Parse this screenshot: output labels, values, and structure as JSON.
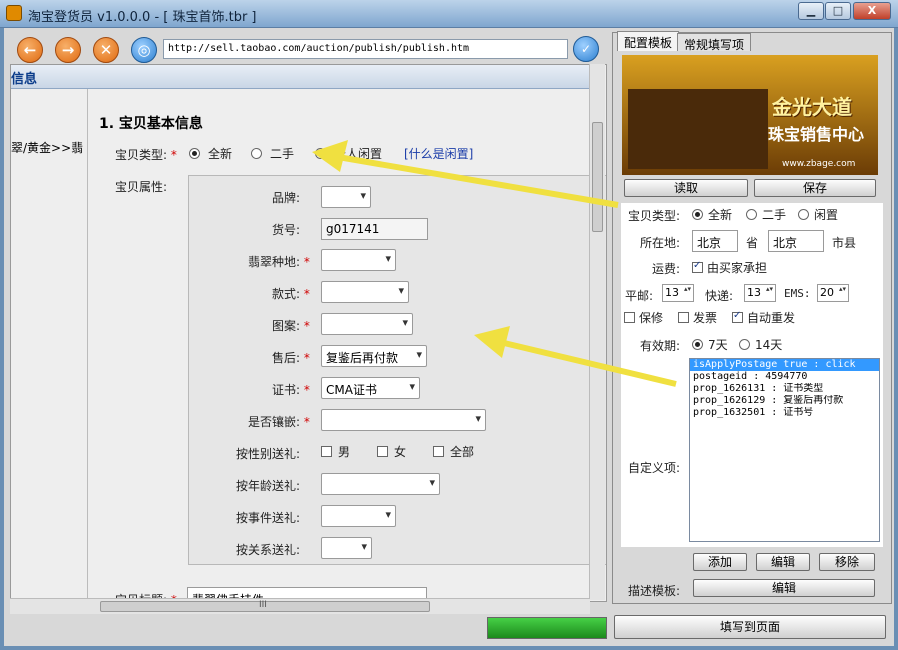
{
  "window": {
    "title": "淘宝登货员 v1.0.0.0 - [ 珠宝首饰.tbr ]",
    "min": "▁",
    "max": "□",
    "close": "X"
  },
  "toolbar": {
    "back": "←",
    "forward": "→",
    "stop": "✕",
    "home": "◎",
    "url": "http://sell.taobao.com/auction/publish/publish.htm",
    "go": "✓"
  },
  "page": {
    "header": "信息",
    "category": "翠/黄金>>翡",
    "section_title": "1. 宝贝基本信息",
    "type_label": "宝贝类型:",
    "type_options": [
      "全新",
      "二手",
      "个人闲置"
    ],
    "type_link": "[什么是闲置]",
    "attr_label": "宝贝属性:",
    "fields": {
      "brand": "品牌:",
      "item_no": "货号:",
      "item_no_value": "g017141",
      "origin": "翡翠种地:",
      "style": "款式:",
      "pattern": "图案:",
      "aftersale": "售后:",
      "aftersale_value": "复鉴后再付款",
      "cert": "证书:",
      "cert_value": "CMA证书",
      "inlay": "是否镶嵌:",
      "gender": "按性别送礼:",
      "gender_opts": [
        "男",
        "女",
        "全部"
      ],
      "age": "按年龄送礼:",
      "event": "按事件送礼:",
      "relation": "按关系送礼:"
    },
    "title_label": "宝贝标题:",
    "title_value": "翡翠佛手挂件"
  },
  "hscroll_label": "III",
  "right": {
    "tabs": [
      "配置模板",
      "常规填写项"
    ],
    "banner": {
      "line1": "金光大道",
      "line2": "珠宝销售中心",
      "url": "www.zbage.com"
    },
    "read": "读取",
    "save": "保存",
    "type_label": "宝贝类型:",
    "type_options": [
      "全新",
      "二手",
      "闲置"
    ],
    "location_label": "所在地:",
    "province": "北京",
    "province_unit": "省",
    "city": "北京",
    "city_unit": "市县",
    "shipping_label": "运费:",
    "shipping_check": "由买家承担",
    "mail_label": "平邮:",
    "mail_value": "13",
    "express_label": "快递:",
    "express_value": "13",
    "ems_label": "EMS:",
    "ems_value": "20",
    "warranty": "保修",
    "invoice": "发票",
    "autorepub": "自动重发",
    "validity_label": "有效期:",
    "validity_options": [
      "7天",
      "14天"
    ],
    "custom_label": "自定义项:",
    "custom_items": [
      "isApplyPostage true : click",
      "postageid : 4594770",
      "prop_1626131 : 证书类型",
      "prop_1626129 : 复鉴后再付款",
      "prop_1632501 : 证书号"
    ],
    "add": "添加",
    "edit": "编辑",
    "remove": "移除",
    "desc_label": "描述模板:",
    "desc_edit": "编辑",
    "fill": "填写到页面"
  },
  "colors": {
    "arrow": "#f0e040",
    "required": "#d00000",
    "selection": "#3399ff"
  }
}
